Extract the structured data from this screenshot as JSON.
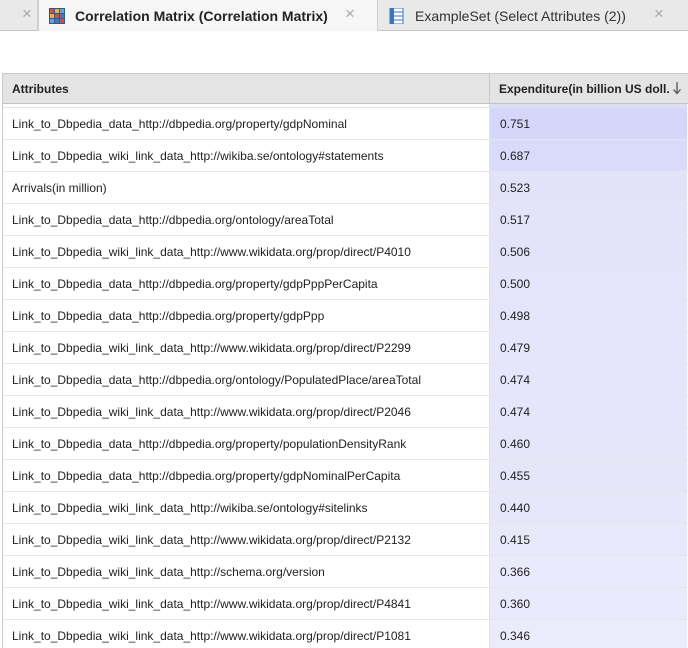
{
  "tabs": [
    {
      "label": "",
      "close": "×"
    },
    {
      "label": "Correlation Matrix (Correlation Matrix)",
      "close": "×",
      "icon": "matrix-icon"
    },
    {
      "label": "ExampleSet (Select Attributes (2))",
      "close": "×",
      "icon": "table-icon"
    }
  ],
  "table": {
    "headers": {
      "attributes": "Attributes",
      "expenditure": "Expenditure(in billion US doll..."
    },
    "sort": "descending",
    "rows": [
      {
        "attribute": "Link_to_Dbpedia_data_http://dbpedia.org/property/gdpNominal",
        "value": "0.751",
        "color": "#d6d6fb"
      },
      {
        "attribute": "Link_to_Dbpedia_wiki_link_data_http://wikiba.se/ontology#statements",
        "value": "0.687",
        "color": "#dadafb"
      },
      {
        "attribute": "Arrivals(in million)",
        "value": "0.523",
        "color": "#e2e2fb"
      },
      {
        "attribute": "Link_to_Dbpedia_data_http://dbpedia.org/ontology/areaTotal",
        "value": "0.517",
        "color": "#e3e3fb"
      },
      {
        "attribute": "Link_to_Dbpedia_wiki_link_data_http://www.wikidata.org/prop/direct/P4010",
        "value": "0.506",
        "color": "#e3e3fb"
      },
      {
        "attribute": "Link_to_Dbpedia_data_http://dbpedia.org/property/gdpPppPerCapita",
        "value": "0.500",
        "color": "#e4e4fb"
      },
      {
        "attribute": "Link_to_Dbpedia_data_http://dbpedia.org/property/gdpPpp",
        "value": "0.498",
        "color": "#e4e4fb"
      },
      {
        "attribute": "Link_to_Dbpedia_wiki_link_data_http://www.wikidata.org/prop/direct/P2299",
        "value": "0.479",
        "color": "#e5e5fb"
      },
      {
        "attribute": "Link_to_Dbpedia_data_http://dbpedia.org/ontology/PopulatedPlace/areaTotal",
        "value": "0.474",
        "color": "#e5e5fb"
      },
      {
        "attribute": "Link_to_Dbpedia_wiki_link_data_http://www.wikidata.org/prop/direct/P2046",
        "value": "0.474",
        "color": "#e5e5fb"
      },
      {
        "attribute": "Link_to_Dbpedia_data_http://dbpedia.org/property/populationDensityRank",
        "value": "0.460",
        "color": "#e6e6fb"
      },
      {
        "attribute": "Link_to_Dbpedia_data_http://dbpedia.org/property/gdpNominalPerCapita",
        "value": "0.455",
        "color": "#e6e6fb"
      },
      {
        "attribute": "Link_to_Dbpedia_wiki_link_data_http://wikiba.se/ontology#sitelinks",
        "value": "0.440",
        "color": "#e7e7fb"
      },
      {
        "attribute": "Link_to_Dbpedia_wiki_link_data_http://www.wikidata.org/prop/direct/P2132",
        "value": "0.415",
        "color": "#e8e8fb"
      },
      {
        "attribute": "Link_to_Dbpedia_wiki_link_data_http://schema.org/version",
        "value": "0.366",
        "color": "#eaeafc"
      },
      {
        "attribute": "Link_to_Dbpedia_wiki_link_data_http://www.wikidata.org/prop/direct/P4841",
        "value": "0.360",
        "color": "#eaeafc"
      },
      {
        "attribute": "Link_to_Dbpedia_wiki_link_data_http://www.wikidata.org/prop/direct/P1081",
        "value": "0.346",
        "color": "#ebebfc"
      }
    ]
  }
}
